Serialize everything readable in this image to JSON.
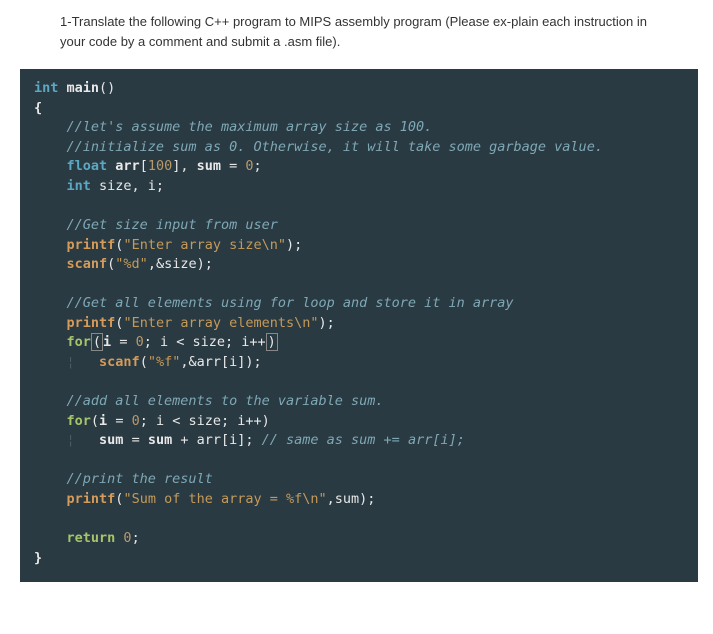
{
  "question": {
    "number": "1-",
    "text": "Translate the following C++ program to MIPS assembly program (Please ex-plain each instruction in your code by a comment and submit a .asm file)."
  },
  "code": {
    "line1_type": "int",
    "line1_fn": "main",
    "line1_paren": "()",
    "line2_brace": "{",
    "line3_comment": "//let's assume the maximum array size as 100.",
    "line4_comment": "//initialize sum as 0. Otherwise, it will take some garbage value.",
    "line5_type": "float",
    "line5_rest": " arr[100], sum = 0;",
    "line5_arr": "arr",
    "line5_br1": "[",
    "line5_100": "100",
    "line5_br2": "]",
    "line5_comma": ", ",
    "line5_sum": "sum",
    "line5_eq": " = ",
    "line5_zero": "0",
    "line5_semi": ";",
    "line6_type": "int",
    "line6_vars": " size, i;",
    "line8_comment": "//Get size input from user",
    "line9_fn": "printf",
    "line9_p1": "(",
    "line9_str": "\"Enter array size\\n\"",
    "line9_p2": ");",
    "line10_fn": "scanf",
    "line10_p1": "(",
    "line10_str": "\"%d\"",
    "line10_rest": ",&size);",
    "line12_comment": "//Get all elements using for loop and store it in array",
    "line13_fn": "printf",
    "line13_p1": "(",
    "line13_str": "\"Enter array elements\\n\"",
    "line13_p2": ");",
    "line14_for": "for",
    "line14_p1": "(",
    "line14_i": "i",
    "line14_eq": " = ",
    "line14_zero": "0",
    "line14_semi1": "; ",
    "line14_cond": "i < size; i++",
    "line14_p2": ")",
    "line15_fn": "scanf",
    "line15_p1": "(",
    "line15_str": "\"%f\"",
    "line15_rest": ",&arr[i]);",
    "line17_comment": "//add all elements to the variable sum.",
    "line18_for": "for",
    "line18_rest": "(i = 0; i < size; i++)",
    "line18_p1": "(",
    "line18_i": "i",
    "line18_eq": " = ",
    "line18_zero": "0",
    "line18_semi1": "; ",
    "line18_cond": "i < size; i++)",
    "line19_sum": "sum",
    "line19_eq": " = ",
    "line19_sum2": "sum",
    "line19_plus": " + ",
    "line19_arr": "arr[i];",
    "line19_comment": " // same as sum += arr[i];",
    "line21_comment": "//print the result",
    "line22_fn": "printf",
    "line22_p1": "(",
    "line22_str": "\"Sum of the array = %f\\n\"",
    "line22_rest": ",sum);",
    "line24_return": "return",
    "line24_zero": " 0",
    "line24_semi": ";",
    "line25_brace": "}",
    "indent_bar": "¦"
  }
}
